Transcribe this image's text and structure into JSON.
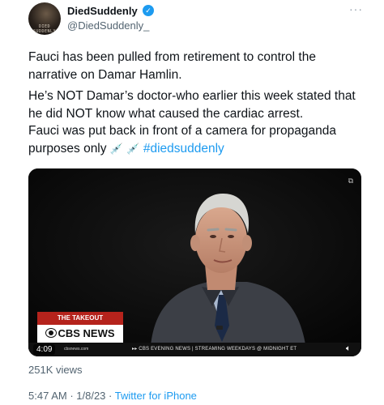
{
  "author": {
    "display_name": "DiedSuddenly",
    "handle": "@DiedSuddenly_",
    "avatar_text": "DIED SUDDENLY"
  },
  "tweet": {
    "paragraphs": [
      "Fauci has been pulled from retirement to control the narrative on Damar Hamlin.",
      "He’s NOT Damar’s doctor-who earlier this week stated that he did NOT know what caused the cardiac arrest.",
      "Fauci was put back in front of a camera for propaganda purposes only"
    ],
    "hashtag": "#diedsuddenly"
  },
  "media": {
    "segment_label": "THE TAKEOUT",
    "network_logo": "CBS NEWS",
    "duration": "4:09",
    "ticker_site": "cbsnews.com",
    "ticker_text": "▸▸ CBS EVENING NEWS | STREAMING WEEKDAYS @ MIDNIGHT ET"
  },
  "stats": {
    "views": "251K views"
  },
  "meta": {
    "time": "5:47 AM",
    "date": "1/8/23",
    "client": "Twitter for iPhone"
  },
  "icons": {
    "verified": "verified-badge",
    "more": "more-horizontal-icon",
    "syringe": "syringe-emoji",
    "volume": "volume-icon"
  },
  "colors": {
    "accent": "#1d9bf0",
    "secondary_text": "#536471",
    "cbs_red": "#b5231c"
  }
}
